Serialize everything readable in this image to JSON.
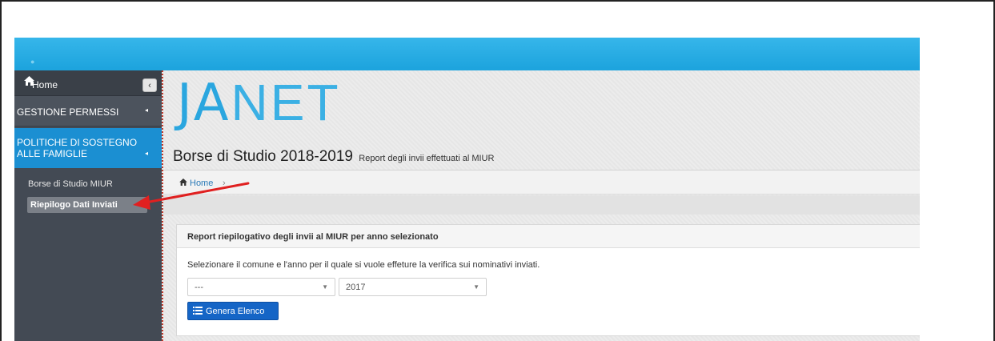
{
  "sidebar": {
    "home_label": "Home",
    "collapse_glyph": "‹",
    "items": [
      {
        "label": "GESTIONE PERMESSI",
        "arrow": "◂"
      },
      {
        "label_line1": "POLITICHE DI SOSTEGNO",
        "label_line2": "ALLE FAMIGLIE",
        "arrow": "◂"
      }
    ],
    "submenu": [
      {
        "label": "Borse di Studio MIUR"
      },
      {
        "label": "Riepilogo Dati Inviati"
      }
    ]
  },
  "header": {
    "logo_part1": "JA",
    "logo_part2": "NET",
    "title": "Borse di Studio 2018-2019",
    "subtitle": "Report degli invii effettuati al MIUR"
  },
  "breadcrumb": {
    "home_label": "Home",
    "separator": "›"
  },
  "panel": {
    "title": "Report riepilogativo degli invii al MIUR per anno selezionato",
    "description": "Selezionare il comune e l'anno per il quale si vuole effeture la verifica sui nominativi inviati.",
    "select_comune_value": "---",
    "select_anno_value": "2017",
    "button_label": "Genera Elenco"
  },
  "icons": {
    "home": "home-icon",
    "list": "list-icon",
    "caret": "caret-down-icon",
    "annotation": "red-arrow-annotation"
  },
  "colors": {
    "topbar": "#1ca3dd",
    "sidebar": "#434a54",
    "active_menu": "#1b8fd2",
    "button": "#1565c6",
    "annotation_arrow": "#e02020"
  }
}
